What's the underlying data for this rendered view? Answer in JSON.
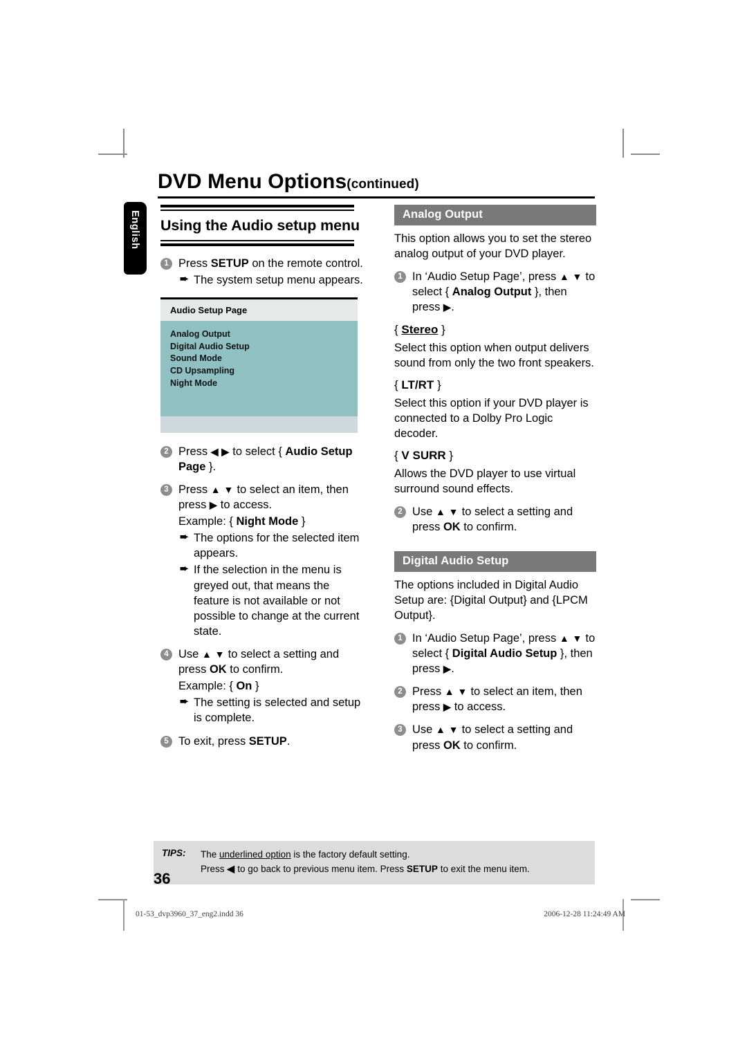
{
  "document": {
    "title_main": "DVD Menu Options",
    "title_continued": "(continued)",
    "language_tab": "English",
    "page_number": "36"
  },
  "left_column": {
    "heading": "Using the Audio setup menu",
    "steps": [
      {
        "num": "1",
        "text_parts": [
          "Press ",
          "SETUP",
          " on the remote control."
        ],
        "results": [
          "The system setup menu appears."
        ]
      },
      {
        "num": "2",
        "text_parts": [
          "Press ",
          "◀ ▶",
          " to select { ",
          "Audio Setup Page",
          " }."
        ],
        "results": []
      },
      {
        "num": "3",
        "text_parts": [
          "Press ",
          "▲ ▼",
          " to select an item, then press ",
          "▶",
          " to access."
        ],
        "example": "Example: { Night Mode }",
        "example_label": "Example: {",
        "example_value": "Night Mode",
        "example_close": "}",
        "results": [
          "The options for the selected item appears.",
          "If the selection in the menu is greyed out, that means the feature is not available or not possible to change at the current state."
        ]
      },
      {
        "num": "4",
        "text_parts": [
          "Use ",
          "▲ ▼",
          " to select a setting and press ",
          "OK",
          " to confirm."
        ],
        "example_label": "Example: {",
        "example_value": "On",
        "example_close": "}",
        "results": [
          "The setting is selected and setup is complete."
        ]
      },
      {
        "num": "5",
        "text_parts": [
          "To exit, press ",
          "SETUP",
          "."
        ],
        "results": []
      }
    ],
    "osd": {
      "header": "Audio Setup Page",
      "items": [
        "Analog Output",
        "Digital Audio Setup",
        "Sound Mode",
        "CD Upsampling",
        "Night Mode"
      ]
    }
  },
  "right_column": {
    "sections": [
      {
        "bar_title": "Analog Output",
        "intro": "This option allows you to set the stereo analog output of your DVD player.",
        "step1_num": "1",
        "step1_a": "In ‘Audio Setup Page’, press ",
        "step1_arrows": "▲ ▼",
        "step1_b": " to select { ",
        "step1_bold": "Analog Output",
        "step1_c": " }, then press ",
        "step1_arrow_right": "▶",
        "step1_d": ".",
        "options": [
          {
            "open": "{",
            "name": "Stereo",
            "underlined": true,
            "close": "}",
            "desc": "Select this option when output delivers sound from only the two front speakers."
          },
          {
            "open": "{",
            "name": "LT/RT",
            "underlined": false,
            "close": "}",
            "desc": "Select this option if your DVD player is connected to a Dolby Pro Logic decoder."
          },
          {
            "open": "{",
            "name": "V SURR",
            "underlined": false,
            "close": "}",
            "desc": "Allows the DVD player to use virtual surround sound effects."
          }
        ],
        "step2_num": "2",
        "step2_a": "Use ",
        "step2_arrows": "▲ ▼",
        "step2_b": " to select a setting and press ",
        "step2_bold": "OK",
        "step2_c": " to confirm."
      },
      {
        "bar_title": "Digital Audio Setup",
        "intro": "The options included in Digital Audio Setup are: {Digital Output} and {LPCM Output}.",
        "step1_num": "1",
        "step1_a": "In ‘Audio Setup Page’, press ",
        "step1_arrows": "▲ ▼",
        "step1_b": " to select { ",
        "step1_bold": "Digital Audio Setup",
        "step1_c": " }, then press ",
        "step1_arrow_right": "▶",
        "step1_d": ".",
        "step2_num": "2",
        "step2_a": "Press ",
        "step2_arrows": "▲ ▼",
        "step2_b": " to select an item, then press ",
        "step2_arrow_right": "▶",
        "step2_c": " to access.",
        "step3_num": "3",
        "step3_a": "Use ",
        "step3_arrows": "▲ ▼",
        "step3_b": " to select a setting and press ",
        "step3_bold": "OK",
        "step3_c": " to confirm."
      }
    ]
  },
  "tips": {
    "label": "TIPS:",
    "line1_a": "The ",
    "line1_underlined": "underlined option",
    "line1_b": " is the factory default setting.",
    "line2_a": "Press ",
    "line2_arrow": "◀",
    "line2_b": " to go back to previous menu item. Press ",
    "line2_bold": "SETUP",
    "line2_c": " to exit the menu item."
  },
  "print_footer": {
    "filename": "01-53_dvp3960_37_eng2.indd   36",
    "timestamp": "2006-12-28   11:24:49 AM"
  },
  "colors": {
    "osd_header_bg": "#e7e8e8",
    "osd_body_bg": "#8fc1c3",
    "osd_footer_bg": "#cdd9dc",
    "section_bar_bg": "#797979",
    "tips_bg": "#dcdcdc",
    "step_bullet_bg": "#8d8d8d",
    "tab_bg": "#000000"
  }
}
